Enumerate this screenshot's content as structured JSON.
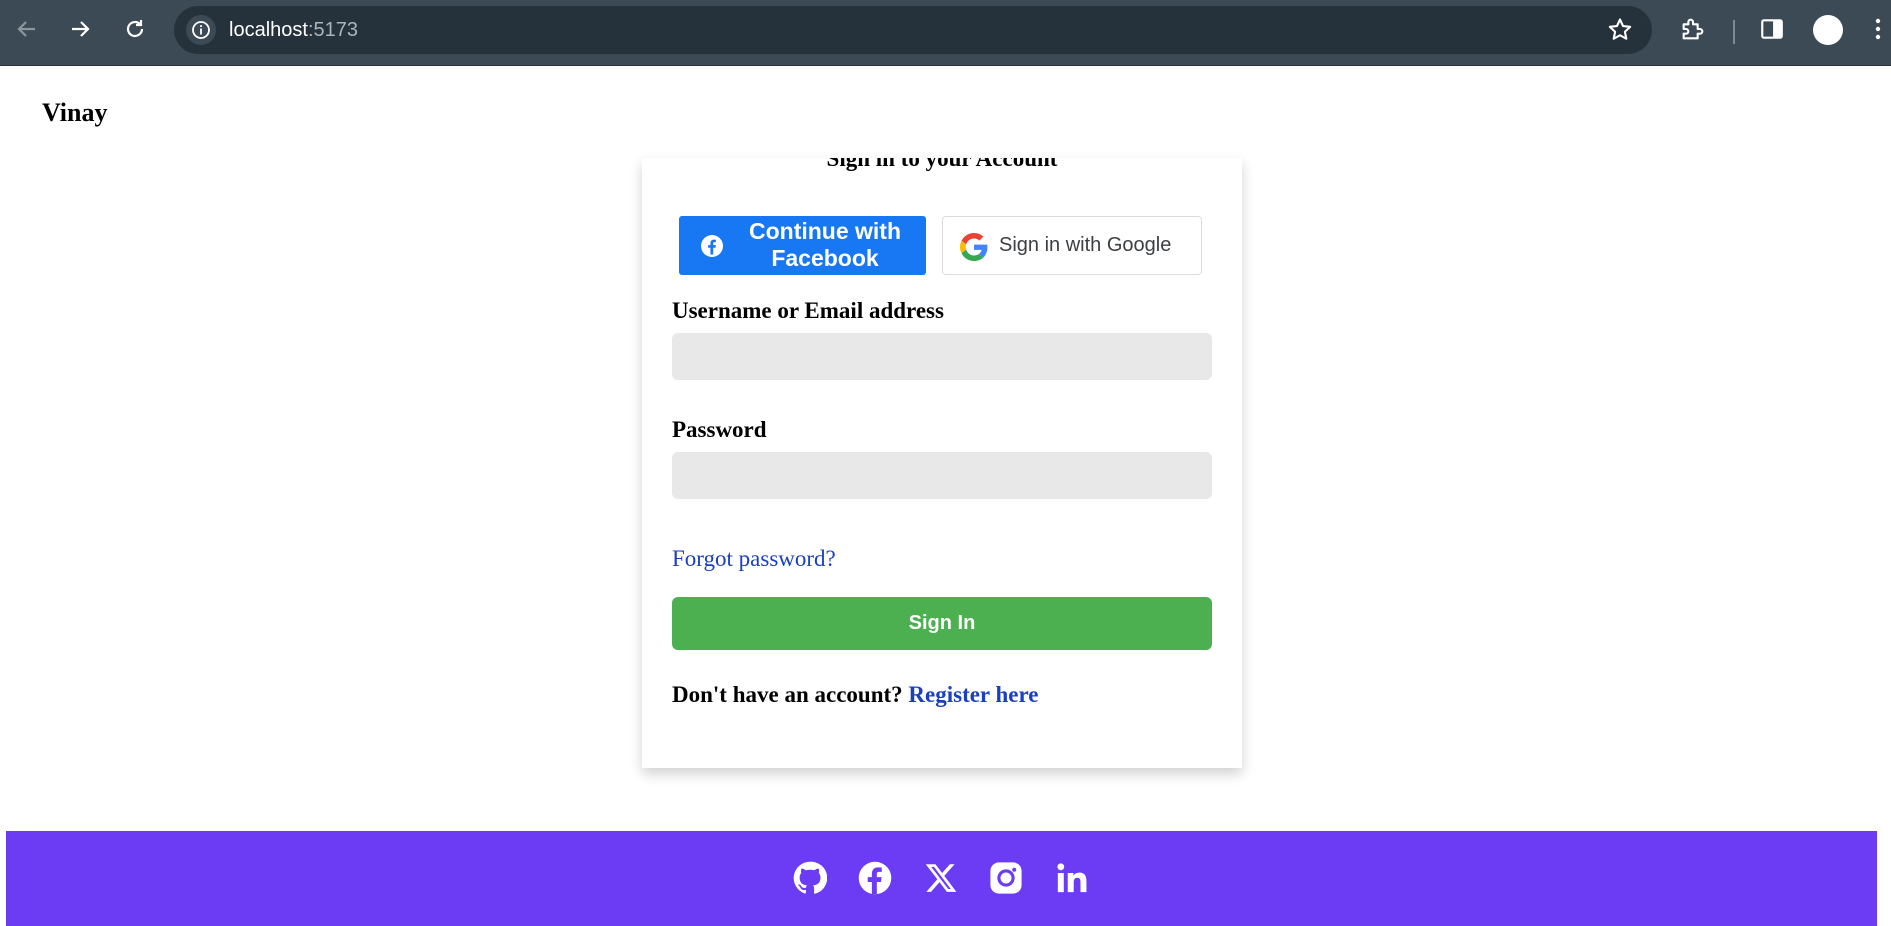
{
  "browser": {
    "url_host": "localhost",
    "url_port": ":5173",
    "icons": [
      "back-arrow-icon",
      "forward-arrow-icon",
      "reload-icon",
      "site-info-icon",
      "bookmark-star-icon",
      "extensions-puzzle-icon",
      "side-panel-icon",
      "profile-avatar-icon",
      "kebab-menu-icon"
    ]
  },
  "header": {
    "brand": "Vinay"
  },
  "login": {
    "title": "Sign in to your Account",
    "facebook_label": "Continue with Facebook",
    "google_label": "Sign in with Google",
    "username_label": "Username or Email address",
    "username_value": "",
    "password_label": "Password",
    "password_value": "",
    "forgot_link": "Forgot password?",
    "submit_label": "Sign In",
    "no_account_text": "Don't have an account?",
    "register_link": "Register here"
  },
  "footer": {
    "social_icons": [
      "github-icon",
      "facebook-icon",
      "x-twitter-icon",
      "instagram-icon",
      "linkedin-icon"
    ]
  },
  "colors": {
    "chrome_bg": "#3c4a55",
    "facebook_blue": "#1877f2",
    "signin_green": "#4caf50",
    "footer_purple": "#6c3cf5",
    "link_blue": "#1a3fc0",
    "input_bg": "#e8e8e8"
  }
}
